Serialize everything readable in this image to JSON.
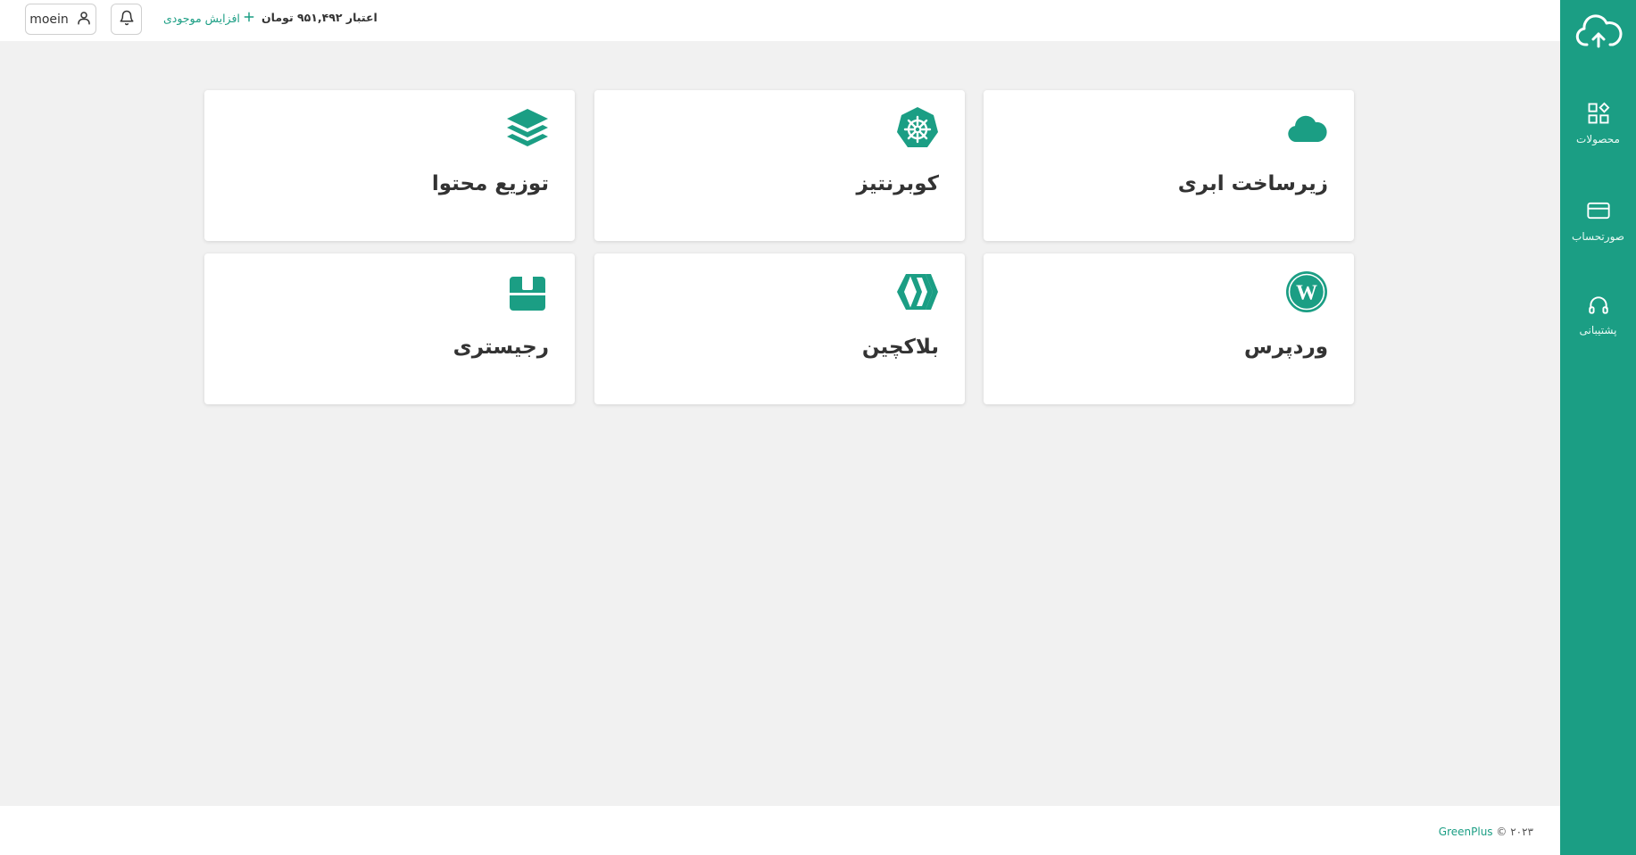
{
  "colors": {
    "accent": "#1b9e84",
    "background": "#f1f1f1",
    "card": "#ffffff"
  },
  "header": {
    "username": "moein",
    "topup_label": "افزایش موجودی",
    "credit_label": "اعتبار",
    "credit_amount": "۹۵۱,۴۹۲",
    "credit_currency": "تومان"
  },
  "sidebar": {
    "items": [
      {
        "label": "محصولات",
        "icon": "products-icon"
      },
      {
        "label": "صورتحساب",
        "icon": "credit-card-icon"
      },
      {
        "label": "پشتیبانی",
        "icon": "headset-icon"
      }
    ]
  },
  "products": [
    {
      "title": "زیرساخت ابری",
      "icon": "cloud-icon"
    },
    {
      "title": "کوبرنتیز",
      "icon": "kubernetes-icon"
    },
    {
      "title": "توزیع محتوا",
      "icon": "layers-icon"
    },
    {
      "title": "وردپرس",
      "icon": "wordpress-icon"
    },
    {
      "title": "بلاکچین",
      "icon": "blockchain-icon"
    },
    {
      "title": "رجیستری",
      "icon": "box-icon"
    }
  ],
  "footer": {
    "copyright_year": "© ۲۰۲۳",
    "brand": "GreenPlus"
  }
}
